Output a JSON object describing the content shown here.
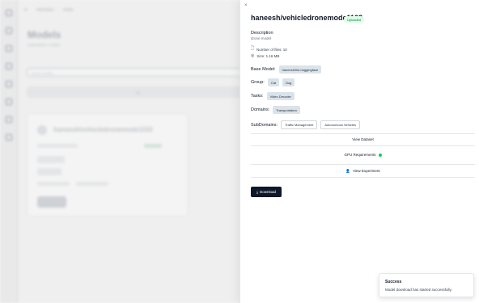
{
  "background": {
    "breadcrumb": [
      "Ai",
      "Marketplace",
      "Models"
    ],
    "page_title": "Models",
    "page_subtitle": "Marketplace models",
    "search_placeholder": "Search models...",
    "tab_label": "All",
    "card_title": "haneesh/vehicledronemode1103",
    "card_button": "Download"
  },
  "drawer": {
    "close_glyph": "×",
    "title": "haneesh/vehicledronemode1103",
    "status_badge": "Uploaded",
    "description_label": "Description",
    "description_value": "drone model",
    "meta": [
      {
        "icon": "file-icon",
        "glyph": "🗋",
        "text": "Number of files: 10"
      },
      {
        "icon": "disk-icon",
        "glyph": "◎",
        "text": "Size: 1.16 MB"
      }
    ],
    "base_model": {
      "label": "Base Model:",
      "value": "haneesh/llm-huggingface"
    },
    "group": {
      "label": "Group:",
      "values": [
        "Cat",
        "Dog"
      ]
    },
    "task": {
      "label": "Tasks:",
      "value": "Video Decoder"
    },
    "domains": {
      "label": "Domains:",
      "value": "Transportation"
    },
    "subdomains": {
      "label": "SubDomains:",
      "values": [
        "Traffic Management",
        "Autonomous Vehicles"
      ]
    },
    "sections": {
      "view_dataset": "View Dataset",
      "gpu_requirements": "GPU Requirements",
      "view_experiment": "View Experiment"
    },
    "download_label": "Download"
  },
  "toast": {
    "title": "Success",
    "message": "Model download has started successfully."
  },
  "colors": {
    "status_green": "#22c55e",
    "chip_bg": "#dbe3ea",
    "primary_button": "#0f172a"
  }
}
